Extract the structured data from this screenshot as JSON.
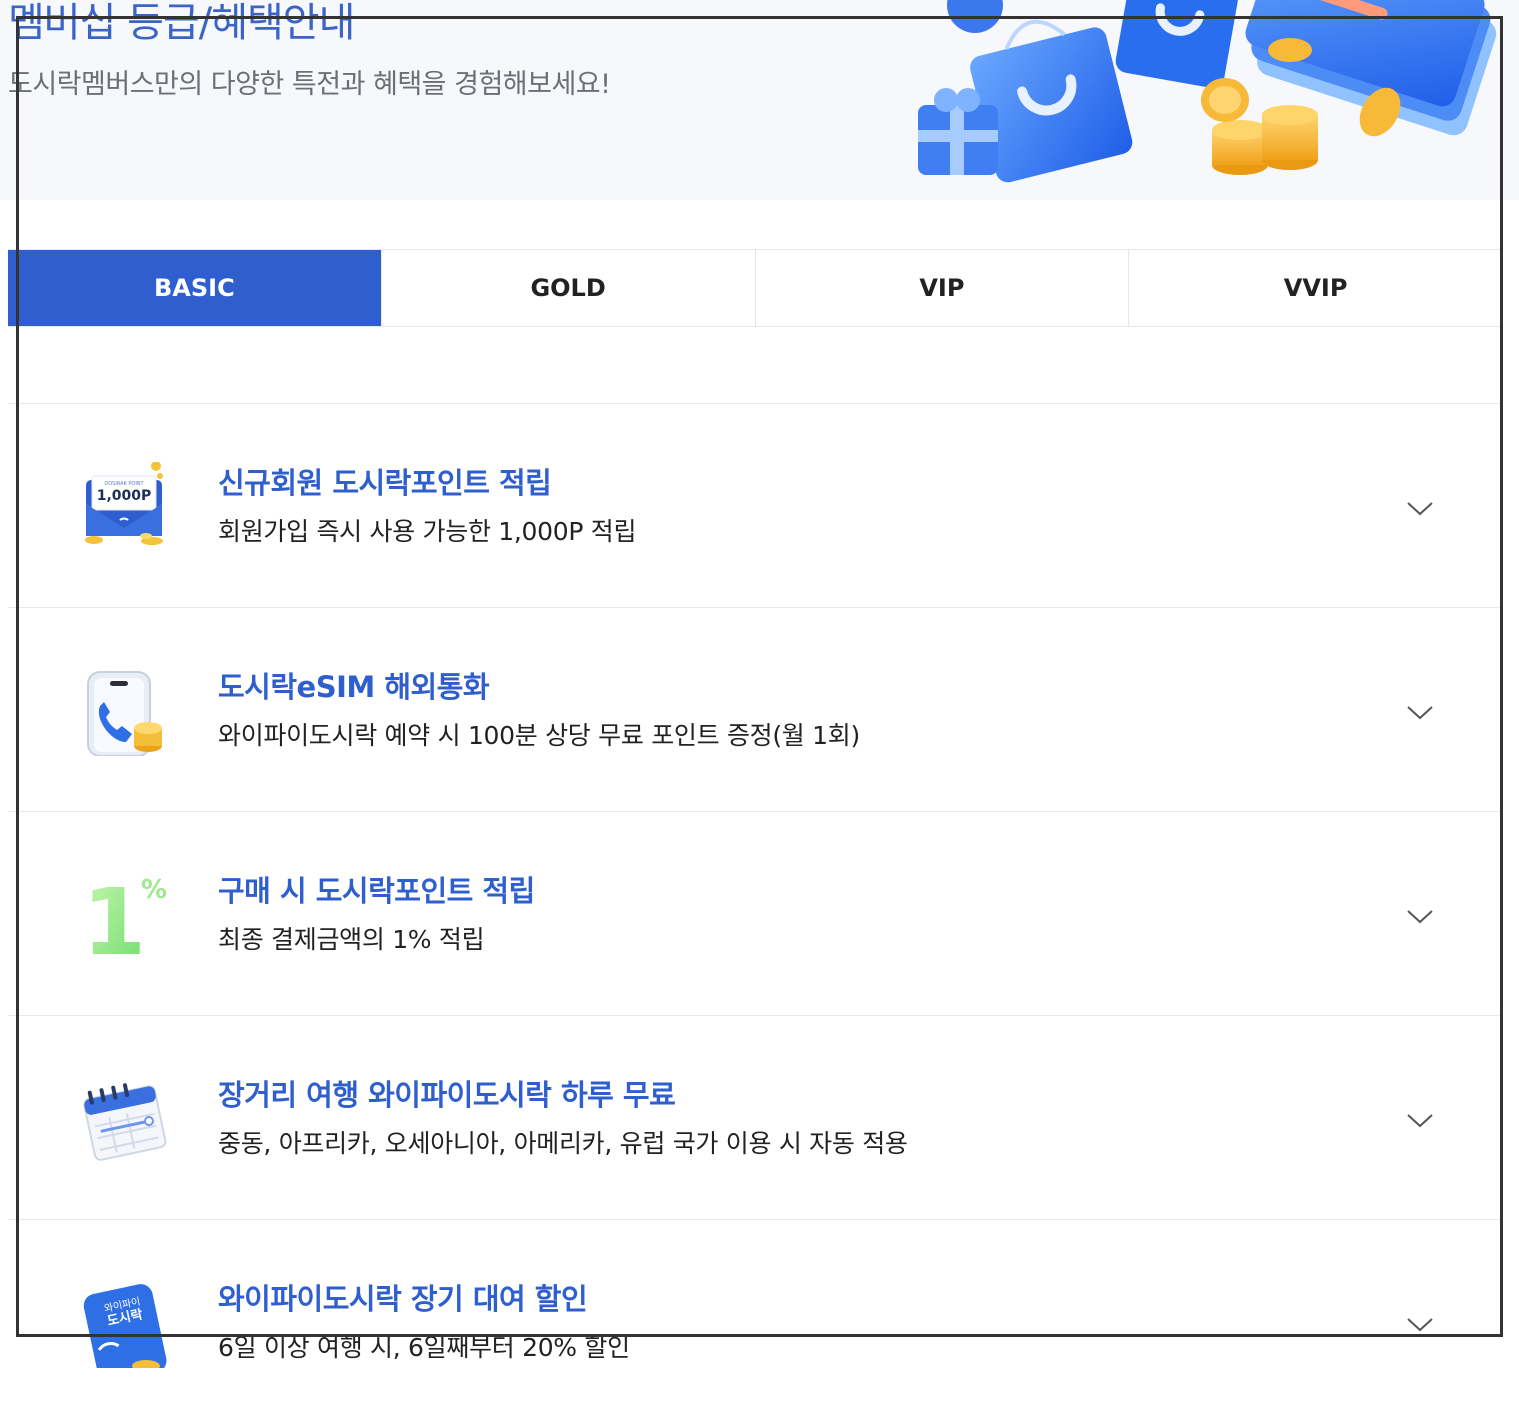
{
  "hero": {
    "title": "멤버십 등급/혜택안내",
    "subtitle": "도시락멤버스만의 다양한 특전과 혜택을 경험해보세요!"
  },
  "tabs": [
    {
      "label": "BASIC",
      "active": true
    },
    {
      "label": "GOLD",
      "active": false
    },
    {
      "label": "VIP",
      "active": false
    },
    {
      "label": "VVIP",
      "active": false
    }
  ],
  "benefits": [
    {
      "icon": "point-envelope-icon",
      "icon_text": "1,000P",
      "icon_caption": "DOSIRAK POINT",
      "title": "신규회원 도시락포인트 적립",
      "desc": "회원가입 즉시 사용 가능한 1,000P 적립"
    },
    {
      "icon": "phone-call-icon",
      "title": "도시락eSIM 해외통화",
      "desc": "와이파이도시락 예약 시 100분 상당 무료 포인트 증정(월 1회)"
    },
    {
      "icon": "one-percent-icon",
      "icon_text": "1",
      "icon_caption": "%",
      "title": "구매 시 도시락포인트 적립",
      "desc": "최종 결제금액의 1% 적립"
    },
    {
      "icon": "calendar-icon",
      "title": "장거리 여행 와이파이도시락 하루 무료",
      "desc": "중동, 아프리카, 오세아니아, 아메리카, 유럽 국가 이용 시 자동 적용"
    },
    {
      "icon": "wifi-device-icon",
      "icon_text": "와이파이",
      "icon_caption": "도시락",
      "title": "와이파이도시락 장기 대여 할인",
      "desc": "6일 이상 여행 시, 6일째부터 20% 할인"
    }
  ],
  "colors": {
    "accent": "#2f5fcf",
    "hero_bg": "#f7f8fc",
    "text": "#222222",
    "muted": "#6c6f78",
    "border": "#e5e6ea"
  }
}
